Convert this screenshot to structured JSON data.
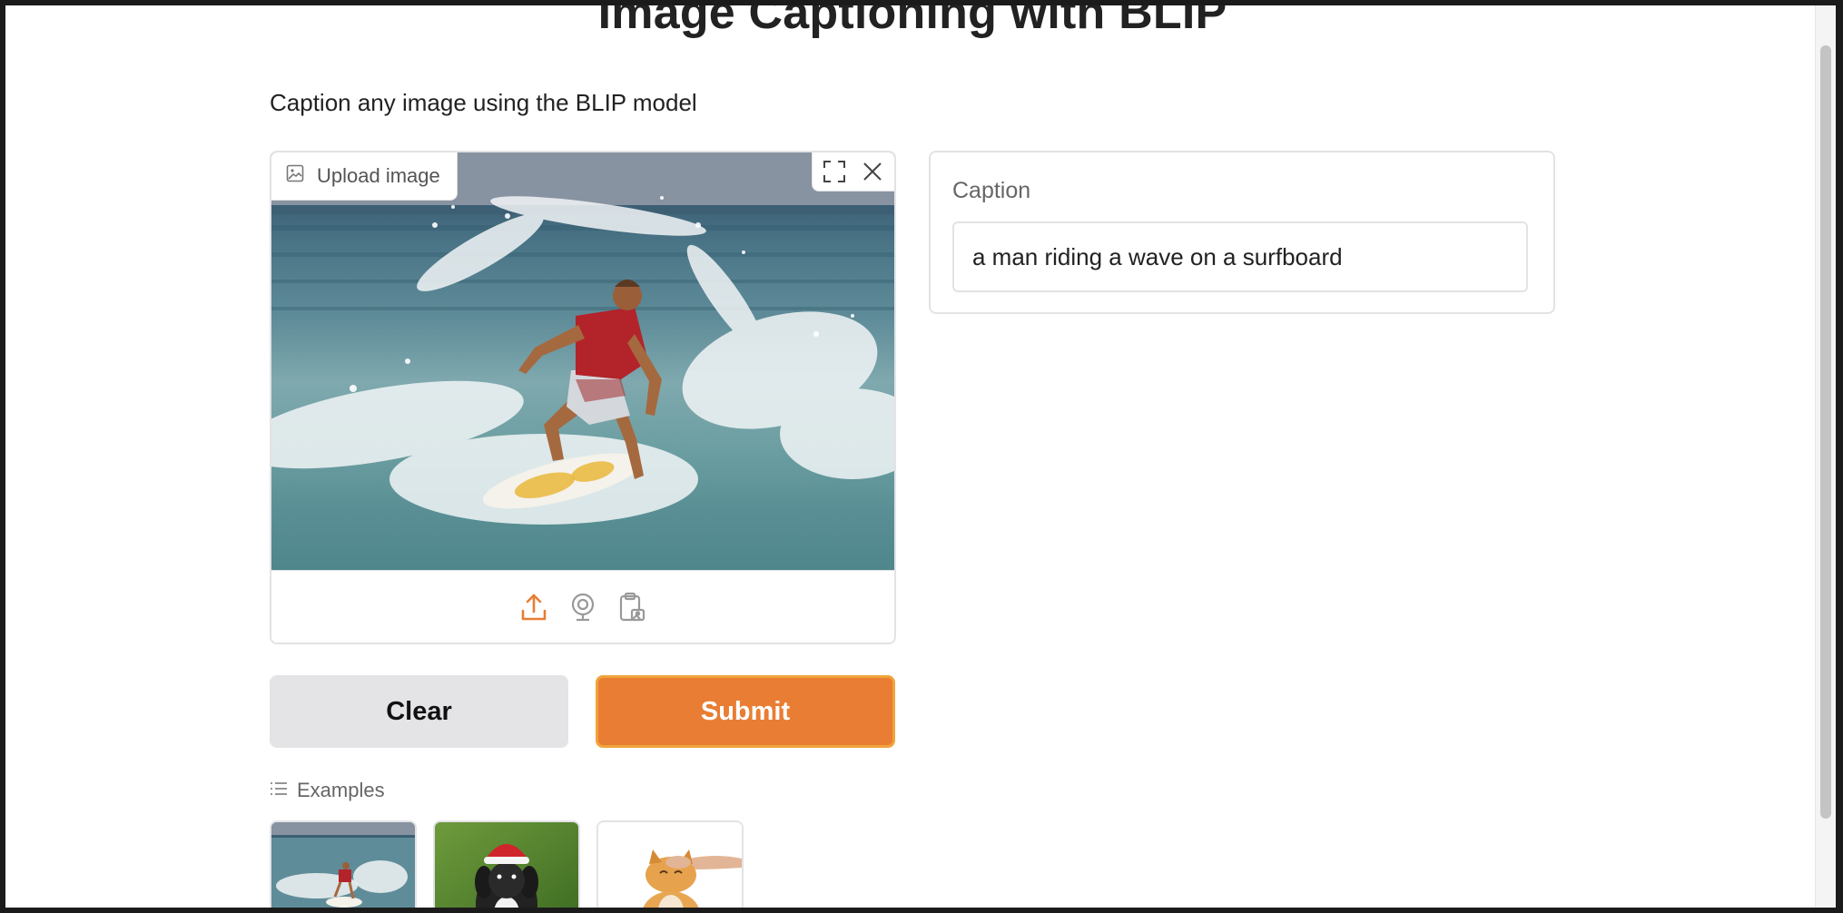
{
  "page": {
    "title": "Image Captioning with BLIP",
    "description": "Caption any image using the BLIP model"
  },
  "image_input": {
    "label": "Upload image",
    "label_icon": "image-icon",
    "controls": [
      "fullscreen-icon",
      "close-icon"
    ],
    "sources": [
      "upload-icon",
      "webcam-icon",
      "clipboard-icon"
    ],
    "image_subject": "surfer on a wave"
  },
  "output": {
    "label": "Caption",
    "value": "a man riding a wave on a surfboard"
  },
  "buttons": {
    "clear": "Clear",
    "submit": "Submit"
  },
  "examples": {
    "label": "Examples",
    "items": [
      "surfer",
      "dog with santa hat",
      "cat"
    ]
  },
  "colors": {
    "accent": "#e97d33",
    "accent_border": "#f0a43a",
    "secondary_button": "#e4e4e7",
    "border": "#e3e3e6"
  }
}
